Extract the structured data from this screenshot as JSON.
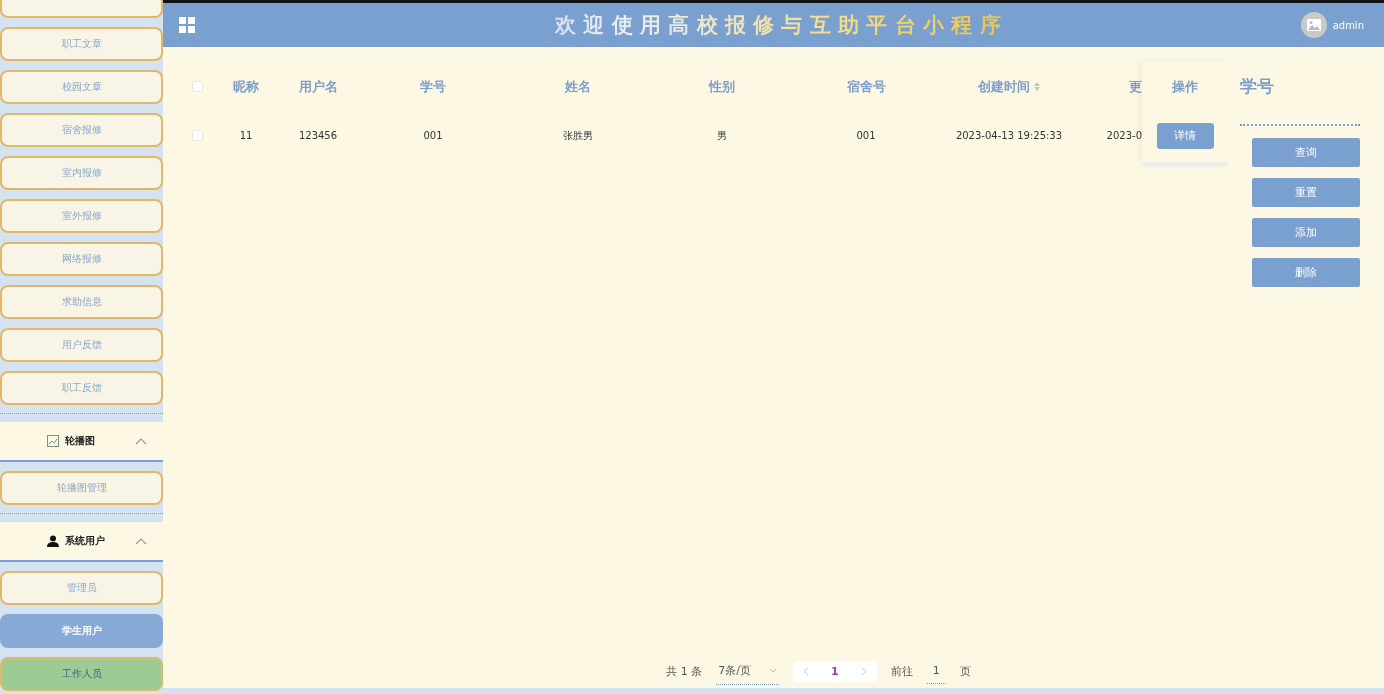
{
  "sidebar": {
    "sections": [
      {
        "items": [
          {
            "selected": false,
            "hovered": false
          },
          {
            "label": "职工文章",
            "selected": false,
            "hovered": false
          },
          {
            "label": "校园文章",
            "selected": false,
            "hovered": false
          },
          {
            "label": "宿舍报修",
            "selected": false,
            "hovered": false
          },
          {
            "label": "室内报修",
            "selected": false,
            "hovered": false
          },
          {
            "label": "室外报修",
            "selected": false,
            "hovered": false
          },
          {
            "label": "网络报修",
            "selected": false,
            "hovered": false
          },
          {
            "label": "求助信息",
            "selected": false,
            "hovered": false
          },
          {
            "label": "用户反馈",
            "selected": false,
            "hovered": false
          },
          {
            "label": "职工反馈",
            "selected": false,
            "hovered": false
          }
        ]
      },
      {
        "title": "轮播图",
        "kind": "image",
        "expanded": true,
        "items": [
          {
            "label": "轮播图管理",
            "selected": false,
            "hovered": false
          }
        ]
      },
      {
        "title": "系统用户",
        "kind": "user",
        "expanded": true,
        "items": [
          {
            "label": "管理员",
            "selected": false,
            "hovered": false
          },
          {
            "label": "学生用户",
            "selected": true,
            "hovered": false
          },
          {
            "label": "工作人员",
            "selected": false,
            "hovered": true
          }
        ]
      }
    ]
  },
  "header": {
    "title": "欢 迎 使 用 高 校 报 修 与 互 助 平 台 小 程 序",
    "user": "admin"
  },
  "table": {
    "all_checked": false,
    "columns": [
      {
        "label": "昵称",
        "sortable": false
      },
      {
        "label": "用户名",
        "sortable": false
      },
      {
        "label": "学号",
        "sortable": false
      },
      {
        "label": "姓名",
        "sortable": false
      },
      {
        "label": "性别",
        "sortable": false
      },
      {
        "label": "宿舍号",
        "sortable": false
      },
      {
        "label": "创建时间",
        "sortable": true
      },
      {
        "label": "更",
        "sortable": false
      }
    ],
    "action_column": "操作",
    "rows": [
      {
        "checked": false,
        "cells": [
          "11",
          "123456",
          "001",
          "张胜男",
          "男",
          "001",
          "2023-04-13 19:25:33",
          "2023-0"
        ],
        "action": "详情"
      }
    ]
  },
  "search_panel": {
    "field_label": "学号",
    "buttons": [
      "查询",
      "重置",
      "添加",
      "删除"
    ]
  },
  "pagination": {
    "total": "共 1 条",
    "page_size": "7条/页",
    "pages": [
      {
        "label": "1",
        "selected": true
      }
    ],
    "goto_label": "前往",
    "goto_value": "1",
    "goto_suffix": "页"
  }
}
